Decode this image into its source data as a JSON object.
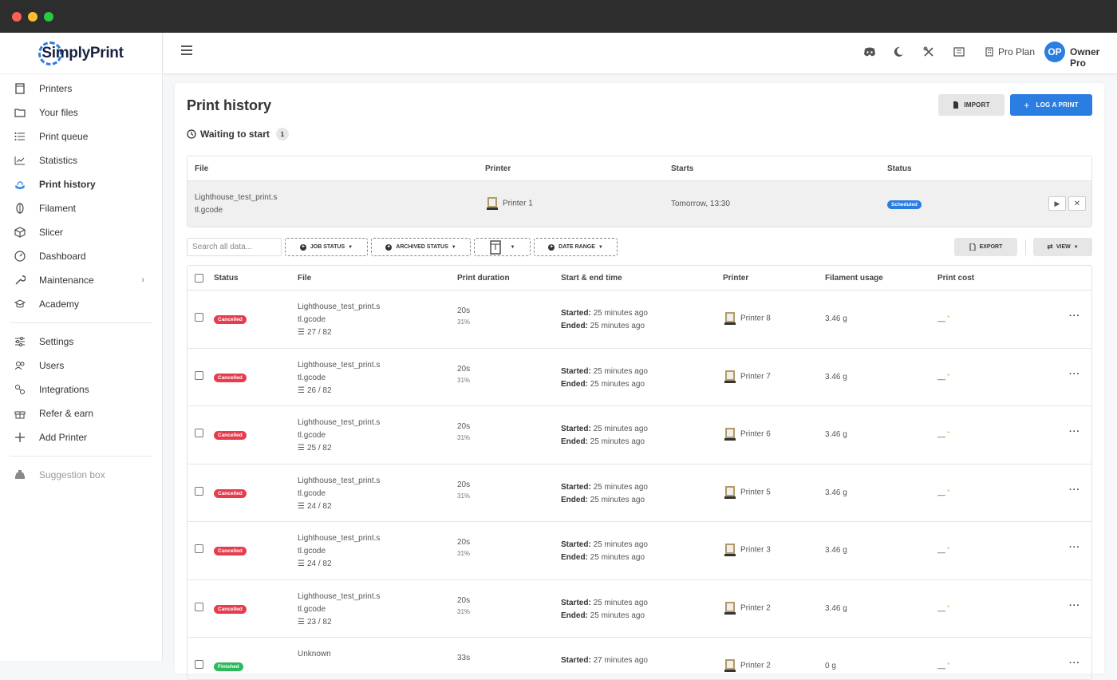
{
  "brand": {
    "name": "SimplyPrint"
  },
  "sidebar": {
    "items": [
      {
        "label": "Printers",
        "icon": "printer-icon"
      },
      {
        "label": "Your files",
        "icon": "folder-icon"
      },
      {
        "label": "Print queue",
        "icon": "list-icon"
      },
      {
        "label": "Statistics",
        "icon": "chart-icon"
      },
      {
        "label": "Print history",
        "icon": "history-icon",
        "active": true
      },
      {
        "label": "Filament",
        "icon": "filament-icon"
      },
      {
        "label": "Slicer",
        "icon": "cube-icon"
      },
      {
        "label": "Dashboard",
        "icon": "dashboard-icon"
      },
      {
        "label": "Maintenance",
        "icon": "wrench-icon"
      },
      {
        "label": "Academy",
        "icon": "graduation-cap-icon"
      }
    ],
    "settings_items": [
      {
        "label": "Settings",
        "icon": "sliders-icon"
      },
      {
        "label": "Users",
        "icon": "users-icon"
      },
      {
        "label": "Integrations",
        "icon": "integrations-icon"
      },
      {
        "label": "Refer & earn",
        "icon": "gift-icon"
      },
      {
        "label": "Add Printer",
        "icon": "plus-icon"
      }
    ],
    "suggestion": "Suggestion box"
  },
  "topbar": {
    "plan": "Pro Plan",
    "avatar_initials": "OP",
    "user_name": "Owner Pro"
  },
  "page": {
    "title": "Print history",
    "import_label": "IMPORT",
    "log_label": "LOG A PRINT",
    "waiting_label": "Waiting to start",
    "waiting_count": "1"
  },
  "waiting_table": {
    "headers": {
      "file": "File",
      "printer": "Printer",
      "starts": "Starts",
      "status": "Status"
    },
    "row": {
      "file_line1": "Lighthouse_test_print.s",
      "file_line2": "tl.gcode",
      "printer": "Printer 1",
      "starts": "Tomorrow, 13:30",
      "status": "Scheduled"
    }
  },
  "filters": {
    "search_placeholder": "Search all data...",
    "job_status": "JOB STATUS",
    "archived_status": "ARCHIVED STATUS",
    "date_range": "DATE RANGE",
    "export": "EXPORT",
    "view": "VIEW"
  },
  "history_table": {
    "headers": {
      "status": "Status",
      "file": "File",
      "duration": "Print duration",
      "time": "Start & end time",
      "printer": "Printer",
      "filament": "Filament usage",
      "cost": "Print cost"
    },
    "started_label": "Started:",
    "ended_label": "Ended:",
    "rows": [
      {
        "status": "Cancelled",
        "file1": "Lighthouse_test_print.s",
        "file2": "tl.gcode",
        "layers": "27 / 82",
        "duration": "20s",
        "percent": "31%",
        "started": "25 minutes ago",
        "ended": "25 minutes ago",
        "printer": "Printer 8",
        "filament": "3.46 g",
        "cost": "—"
      },
      {
        "status": "Cancelled",
        "file1": "Lighthouse_test_print.s",
        "file2": "tl.gcode",
        "layers": "26 / 82",
        "duration": "20s",
        "percent": "31%",
        "started": "25 minutes ago",
        "ended": "25 minutes ago",
        "printer": "Printer 7",
        "filament": "3.46 g",
        "cost": "—"
      },
      {
        "status": "Cancelled",
        "file1": "Lighthouse_test_print.s",
        "file2": "tl.gcode",
        "layers": "25 / 82",
        "duration": "20s",
        "percent": "31%",
        "started": "25 minutes ago",
        "ended": "25 minutes ago",
        "printer": "Printer 6",
        "filament": "3.46 g",
        "cost": "—"
      },
      {
        "status": "Cancelled",
        "file1": "Lighthouse_test_print.s",
        "file2": "tl.gcode",
        "layers": "24 / 82",
        "duration": "20s",
        "percent": "31%",
        "started": "25 minutes ago",
        "ended": "25 minutes ago",
        "printer": "Printer 5",
        "filament": "3.46 g",
        "cost": "—"
      },
      {
        "status": "Cancelled",
        "file1": "Lighthouse_test_print.s",
        "file2": "tl.gcode",
        "layers": "24 / 82",
        "duration": "20s",
        "percent": "31%",
        "started": "25 minutes ago",
        "ended": "25 minutes ago",
        "printer": "Printer 3",
        "filament": "3.46 g",
        "cost": "—"
      },
      {
        "status": "Cancelled",
        "file1": "Lighthouse_test_print.s",
        "file2": "tl.gcode",
        "layers": "23 / 82",
        "duration": "20s",
        "percent": "31%",
        "started": "25 minutes ago",
        "ended": "25 minutes ago",
        "printer": "Printer 2",
        "filament": "3.46 g",
        "cost": "—"
      },
      {
        "status": "Finished",
        "file1": "Unknown",
        "file2": "",
        "layers": "",
        "duration": "33s",
        "percent": "",
        "started": "27 minutes ago",
        "ended": "",
        "printer": "Printer 2",
        "filament": "0 g",
        "cost": "—"
      }
    ]
  },
  "colors": {
    "accent": "#2a7de1",
    "danger": "#e53d4e",
    "success": "#2eb85c",
    "cost_asterisk": "#f0a33a"
  }
}
